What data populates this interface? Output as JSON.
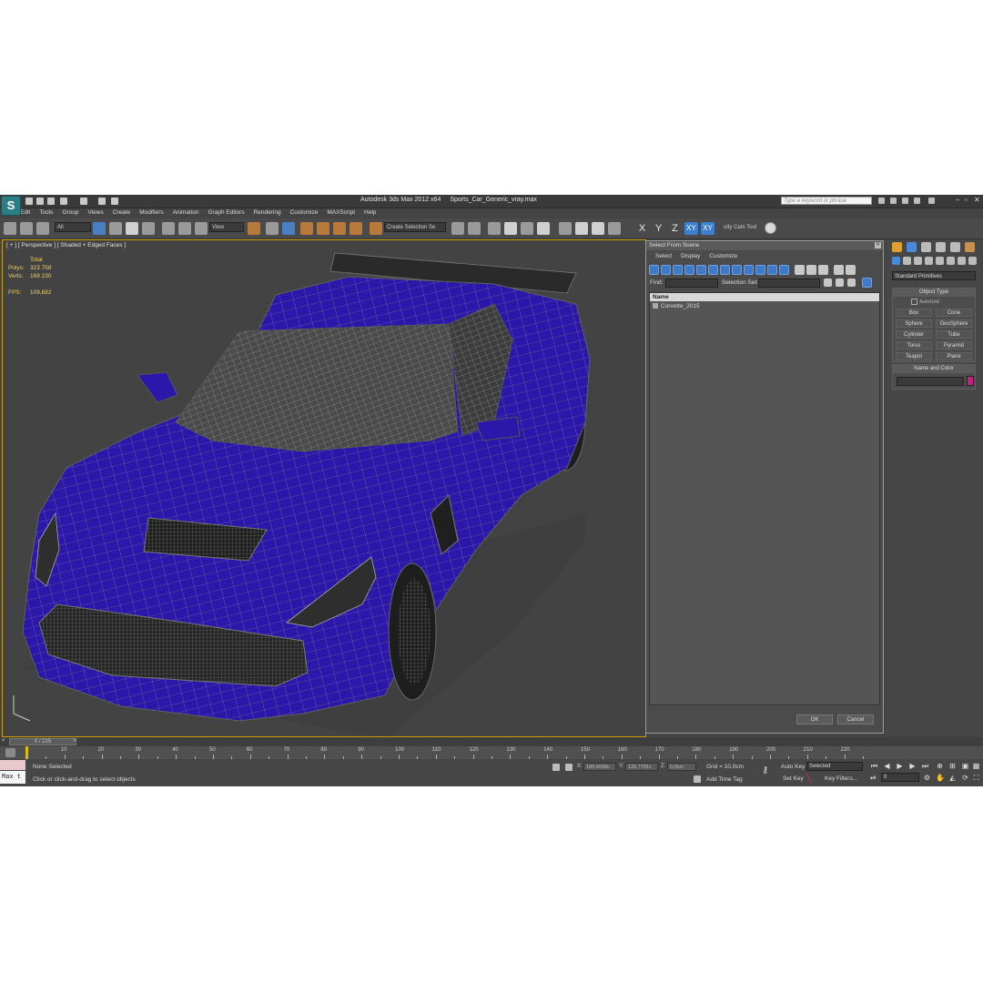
{
  "window": {
    "app_title": "Autodesk 3ds Max  2012 x64",
    "file_name": "Sports_Car_Generic_vray.max",
    "search_placeholder": "Type a keyword or phrase"
  },
  "menu": [
    "Edit",
    "Tools",
    "Group",
    "Views",
    "Create",
    "Modifiers",
    "Animation",
    "Graph Editors",
    "Rendering",
    "Customize",
    "MAXScript",
    "Help"
  ],
  "toolbar": {
    "selection_filter": "All",
    "reference_coord": "View",
    "named_selection": "Create Selection Se",
    "axis": [
      "X",
      "Y",
      "Z",
      "XY",
      "XY"
    ],
    "cam_tool_label": "uity Cam Tool"
  },
  "viewport": {
    "label": "[ + ] [ Perspective ] [ Shaded + Edged Faces ]",
    "stats": {
      "header": "Total",
      "polys_label": "Polys:",
      "polys_value": "323 758",
      "verts_label": "Verts:",
      "verts_value": "168 230",
      "fps_label": "FPS:",
      "fps_value": "109,682"
    },
    "colors": {
      "car_body": "#2a16a8",
      "wire": "#8a8a8a",
      "background": "#434343",
      "active_border": "#c8a000"
    }
  },
  "select_dialog": {
    "title": "Select From Scene",
    "menu": [
      "Select",
      "Display",
      "Customize"
    ],
    "find_label": "Find:",
    "selection_set_label": "Selection Set:",
    "column_name": "Name",
    "items": [
      "Corvette_2015"
    ],
    "ok_label": "OK",
    "cancel_label": "Cancel"
  },
  "command_panel": {
    "category": "Standard Primitives",
    "object_type_title": "Object Type",
    "autogrid_label": "AutoGrid",
    "primitives": [
      "Box",
      "Cone",
      "Sphere",
      "GeoSphere",
      "Cylinder",
      "Tube",
      "Torus",
      "Pyramid",
      "Teapot",
      "Plane"
    ],
    "name_color_title": "Name and Color",
    "swatch_color": "#c82080"
  },
  "timeline": {
    "slider_label": "0 / 225",
    "ticks": [
      "10",
      "20",
      "30",
      "40",
      "50",
      "60",
      "70",
      "80",
      "90",
      "100",
      "110",
      "120",
      "130",
      "140",
      "150",
      "160",
      "170",
      "180",
      "190",
      "200",
      "210",
      "220"
    ]
  },
  "status": {
    "maxscript_label": "Max t",
    "selection_status": "None Selected",
    "prompt": "Click or click-and-drag to select objects",
    "x_label": "X:",
    "x_value": "190,4099c",
    "y_label": "Y:",
    "y_value": "135,7791c",
    "z_label": "Z:",
    "z_value": "0,0cm",
    "grid": "Grid = 10,0cm",
    "add_time_tag": "Add Time Tag",
    "auto_key": "Auto Key",
    "auto_key_mode": "Selected",
    "set_key": "Set Key",
    "key_filters": "Key Filters...",
    "current_frame": "0"
  }
}
